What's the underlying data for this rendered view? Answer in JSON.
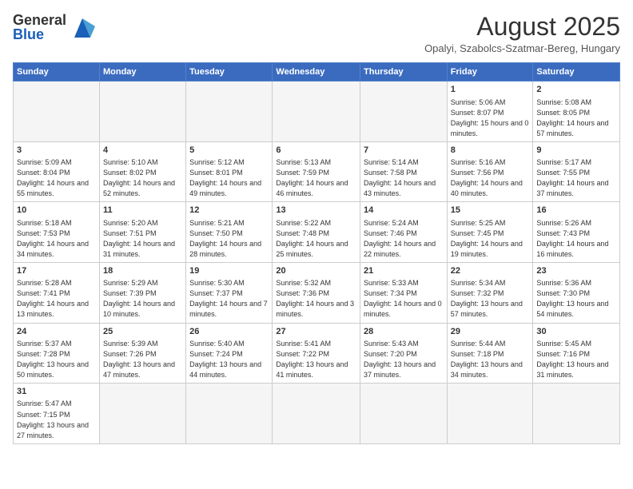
{
  "header": {
    "logo_general": "General",
    "logo_blue": "Blue",
    "month_year": "August 2025",
    "location": "Opalyi, Szabolcs-Szatmar-Bereg, Hungary"
  },
  "weekdays": [
    "Sunday",
    "Monday",
    "Tuesday",
    "Wednesday",
    "Thursday",
    "Friday",
    "Saturday"
  ],
  "weeks": [
    [
      {
        "day": "",
        "info": ""
      },
      {
        "day": "",
        "info": ""
      },
      {
        "day": "",
        "info": ""
      },
      {
        "day": "",
        "info": ""
      },
      {
        "day": "",
        "info": ""
      },
      {
        "day": "1",
        "info": "Sunrise: 5:06 AM\nSunset: 8:07 PM\nDaylight: 15 hours and 0 minutes."
      },
      {
        "day": "2",
        "info": "Sunrise: 5:08 AM\nSunset: 8:05 PM\nDaylight: 14 hours and 57 minutes."
      }
    ],
    [
      {
        "day": "3",
        "info": "Sunrise: 5:09 AM\nSunset: 8:04 PM\nDaylight: 14 hours and 55 minutes."
      },
      {
        "day": "4",
        "info": "Sunrise: 5:10 AM\nSunset: 8:02 PM\nDaylight: 14 hours and 52 minutes."
      },
      {
        "day": "5",
        "info": "Sunrise: 5:12 AM\nSunset: 8:01 PM\nDaylight: 14 hours and 49 minutes."
      },
      {
        "day": "6",
        "info": "Sunrise: 5:13 AM\nSunset: 7:59 PM\nDaylight: 14 hours and 46 minutes."
      },
      {
        "day": "7",
        "info": "Sunrise: 5:14 AM\nSunset: 7:58 PM\nDaylight: 14 hours and 43 minutes."
      },
      {
        "day": "8",
        "info": "Sunrise: 5:16 AM\nSunset: 7:56 PM\nDaylight: 14 hours and 40 minutes."
      },
      {
        "day": "9",
        "info": "Sunrise: 5:17 AM\nSunset: 7:55 PM\nDaylight: 14 hours and 37 minutes."
      }
    ],
    [
      {
        "day": "10",
        "info": "Sunrise: 5:18 AM\nSunset: 7:53 PM\nDaylight: 14 hours and 34 minutes."
      },
      {
        "day": "11",
        "info": "Sunrise: 5:20 AM\nSunset: 7:51 PM\nDaylight: 14 hours and 31 minutes."
      },
      {
        "day": "12",
        "info": "Sunrise: 5:21 AM\nSunset: 7:50 PM\nDaylight: 14 hours and 28 minutes."
      },
      {
        "day": "13",
        "info": "Sunrise: 5:22 AM\nSunset: 7:48 PM\nDaylight: 14 hours and 25 minutes."
      },
      {
        "day": "14",
        "info": "Sunrise: 5:24 AM\nSunset: 7:46 PM\nDaylight: 14 hours and 22 minutes."
      },
      {
        "day": "15",
        "info": "Sunrise: 5:25 AM\nSunset: 7:45 PM\nDaylight: 14 hours and 19 minutes."
      },
      {
        "day": "16",
        "info": "Sunrise: 5:26 AM\nSunset: 7:43 PM\nDaylight: 14 hours and 16 minutes."
      }
    ],
    [
      {
        "day": "17",
        "info": "Sunrise: 5:28 AM\nSunset: 7:41 PM\nDaylight: 14 hours and 13 minutes."
      },
      {
        "day": "18",
        "info": "Sunrise: 5:29 AM\nSunset: 7:39 PM\nDaylight: 14 hours and 10 minutes."
      },
      {
        "day": "19",
        "info": "Sunrise: 5:30 AM\nSunset: 7:37 PM\nDaylight: 14 hours and 7 minutes."
      },
      {
        "day": "20",
        "info": "Sunrise: 5:32 AM\nSunset: 7:36 PM\nDaylight: 14 hours and 3 minutes."
      },
      {
        "day": "21",
        "info": "Sunrise: 5:33 AM\nSunset: 7:34 PM\nDaylight: 14 hours and 0 minutes."
      },
      {
        "day": "22",
        "info": "Sunrise: 5:34 AM\nSunset: 7:32 PM\nDaylight: 13 hours and 57 minutes."
      },
      {
        "day": "23",
        "info": "Sunrise: 5:36 AM\nSunset: 7:30 PM\nDaylight: 13 hours and 54 minutes."
      }
    ],
    [
      {
        "day": "24",
        "info": "Sunrise: 5:37 AM\nSunset: 7:28 PM\nDaylight: 13 hours and 50 minutes."
      },
      {
        "day": "25",
        "info": "Sunrise: 5:39 AM\nSunset: 7:26 PM\nDaylight: 13 hours and 47 minutes."
      },
      {
        "day": "26",
        "info": "Sunrise: 5:40 AM\nSunset: 7:24 PM\nDaylight: 13 hours and 44 minutes."
      },
      {
        "day": "27",
        "info": "Sunrise: 5:41 AM\nSunset: 7:22 PM\nDaylight: 13 hours and 41 minutes."
      },
      {
        "day": "28",
        "info": "Sunrise: 5:43 AM\nSunset: 7:20 PM\nDaylight: 13 hours and 37 minutes."
      },
      {
        "day": "29",
        "info": "Sunrise: 5:44 AM\nSunset: 7:18 PM\nDaylight: 13 hours and 34 minutes."
      },
      {
        "day": "30",
        "info": "Sunrise: 5:45 AM\nSunset: 7:16 PM\nDaylight: 13 hours and 31 minutes."
      }
    ],
    [
      {
        "day": "31",
        "info": "Sunrise: 5:47 AM\nSunset: 7:15 PM\nDaylight: 13 hours and 27 minutes."
      },
      {
        "day": "",
        "info": ""
      },
      {
        "day": "",
        "info": ""
      },
      {
        "day": "",
        "info": ""
      },
      {
        "day": "",
        "info": ""
      },
      {
        "day": "",
        "info": ""
      },
      {
        "day": "",
        "info": ""
      }
    ]
  ]
}
